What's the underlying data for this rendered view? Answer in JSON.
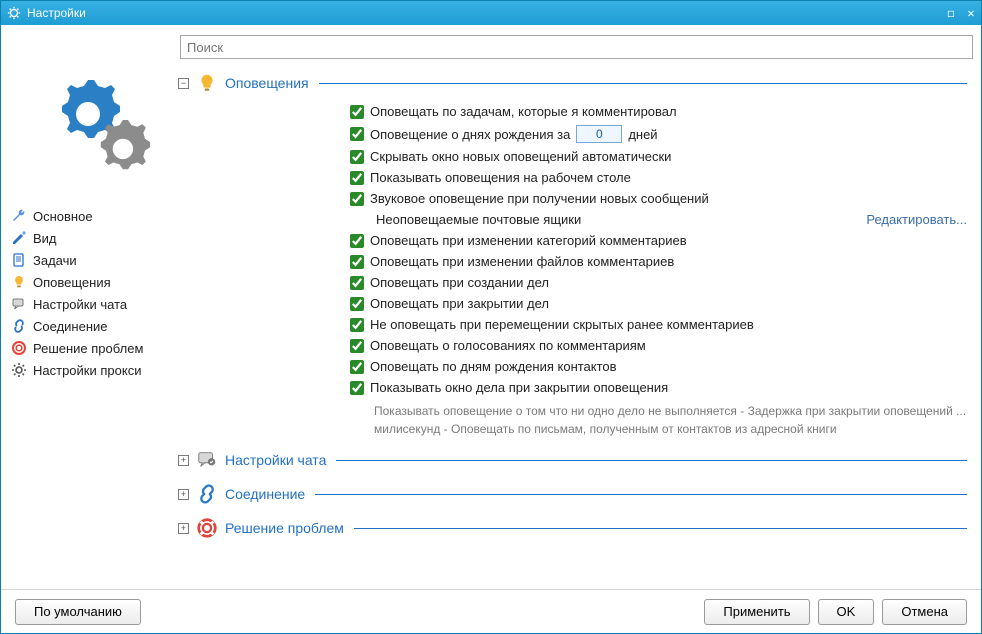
{
  "window": {
    "title": "Настройки"
  },
  "search": {
    "placeholder": "Поиск"
  },
  "nav": {
    "items": [
      {
        "icon": "wrench-icon",
        "label": "Основное",
        "color": "#5a8de0"
      },
      {
        "icon": "brush-icon",
        "label": "Вид",
        "color": "#2a6fc9"
      },
      {
        "icon": "doc-icon",
        "label": "Задачи",
        "color": "#2a6fc9"
      },
      {
        "icon": "bulb-icon",
        "label": "Оповещения",
        "color": "#f5a623"
      },
      {
        "icon": "chat-icon",
        "label": "Настройки чата",
        "color": "#7a7a7a"
      },
      {
        "icon": "link-icon",
        "label": "Соединение",
        "color": "#2a6fc9"
      },
      {
        "icon": "lifebuoy-icon",
        "label": "Решение проблем",
        "color": "#e0443a"
      },
      {
        "icon": "gear-icon",
        "label": "Настройки прокси",
        "color": "#555"
      }
    ]
  },
  "sections": {
    "notifications": {
      "title": "Оповещения",
      "expanded": true,
      "birthday_days_value": "0",
      "birthday_days_suffix": "дней",
      "mailboxes_label": "Неоповещаемые почтовые ящики",
      "edit_link": "Редактировать...",
      "options": [
        {
          "checked": true,
          "label": "Оповещать по задачам, которые я комментировал"
        },
        {
          "checked": true,
          "label": "Оповещение о днях рождения за",
          "inline_num": true
        },
        {
          "checked": true,
          "label": "Скрывать окно новых оповещений автоматически"
        },
        {
          "checked": true,
          "label": "Показывать оповещения на рабочем столе"
        },
        {
          "checked": true,
          "label": "Звуковое оповещение при получении новых сообщений"
        },
        {
          "indent": true
        },
        {
          "checked": true,
          "label": "Оповещать при изменении категорий комментариев"
        },
        {
          "checked": true,
          "label": "Оповещать при изменении файлов комментариев"
        },
        {
          "checked": true,
          "label": "Оповещать при создании дел"
        },
        {
          "checked": true,
          "label": "Оповещать при закрытии дел"
        },
        {
          "checked": true,
          "label": "Не оповещать при перемещении скрытых ранее комментариев"
        },
        {
          "checked": true,
          "label": "Оповещать о голосованиях по комментариям"
        },
        {
          "checked": true,
          "label": "Оповещать по дням рождения контактов"
        },
        {
          "checked": true,
          "label": "Показывать окно дела при закрытии оповещения"
        }
      ],
      "footnote": "Показывать оповещение о том что ни одно дело не выполняется  -   Задержка при закрытии оповещений ... милисекунд  -   Оповещать по письмам, полученным от контактов из адресной книги"
    },
    "chat": {
      "title": "Настройки чата"
    },
    "connection": {
      "title": "Соединение"
    },
    "troubleshoot": {
      "title": "Решение проблем"
    }
  },
  "buttons": {
    "default": "По умолчанию",
    "apply": "Применить",
    "ok": "OK",
    "cancel": "Отмена"
  }
}
